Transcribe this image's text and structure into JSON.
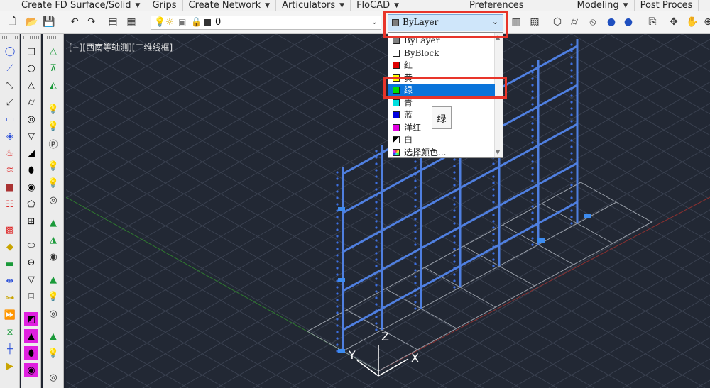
{
  "menu": {
    "items": [
      {
        "label": "Create FD Surface/Solid",
        "arrow": "▼"
      },
      {
        "label": "Grips",
        "arrow": ""
      },
      {
        "label": "Create Network",
        "arrow": "▼"
      },
      {
        "label": "Articulators",
        "arrow": "▼"
      },
      {
        "label": "FloCAD",
        "arrow": "▼"
      },
      {
        "label": "Preferences",
        "arrow": ""
      },
      {
        "label": "Modeling",
        "arrow": "▼"
      },
      {
        "label": "Post Proces",
        "arrow": ""
      }
    ]
  },
  "toolbar": {
    "layer_value": "0",
    "color_value": "ByLayer"
  },
  "viewport": {
    "label": "[−][西南等轴测][二维线框]",
    "axes": {
      "x": "X",
      "y": "Y",
      "z": "Z"
    }
  },
  "color_list": {
    "options": [
      {
        "label": "ByLayer",
        "color": "#808080"
      },
      {
        "label": "ByBlock",
        "color": "#ffffff"
      },
      {
        "label": "红",
        "color": "#e00000"
      },
      {
        "label": "黄",
        "color": "#ffff00"
      },
      {
        "label": "绿",
        "color": "#00e000"
      },
      {
        "label": "青",
        "color": "#00e0e0"
      },
      {
        "label": "蓝",
        "color": "#0000e0"
      },
      {
        "label": "洋红",
        "color": "#e000e0"
      },
      {
        "label": "白",
        "color": "#000000"
      },
      {
        "label": "选择颜色...",
        "color": "#7db7e0"
      }
    ],
    "selected": "绿",
    "tooltip": "绿"
  },
  "colors": {
    "viewport_bg": "#222834",
    "grid": "#3a4150",
    "frame_blue": "#4f7fe0",
    "highlight_red": "#e8352a",
    "selection_blue": "#0a74da"
  }
}
